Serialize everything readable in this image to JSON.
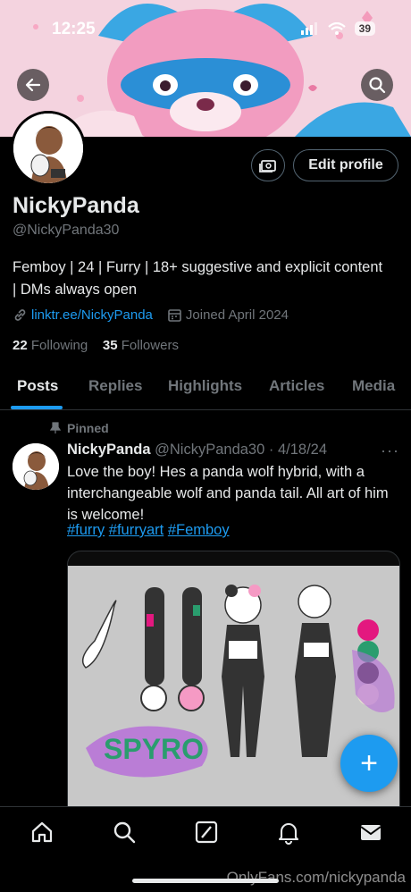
{
  "status_bar": {
    "time": "12:25",
    "battery": "39"
  },
  "profile": {
    "name": "NickyPanda",
    "handle": "@NickyPanda30",
    "bio": "Femboy | 24 | Furry | 18+ suggestive and explicit content | DMs always open",
    "link": "linktr.ee/NickyPanda",
    "joined": "Joined April 2024",
    "following_count": "22",
    "following_label": "Following",
    "followers_count": "35",
    "followers_label": "Followers",
    "edit_label": "Edit profile"
  },
  "tabs": [
    "Posts",
    "Replies",
    "Highlights",
    "Articles",
    "Media"
  ],
  "post": {
    "pinned_label": "Pinned",
    "author": "NickyPanda",
    "handle_date": "@NickyPanda30 · 4/18/24",
    "more": "···",
    "text": "Love the boy! Hes a panda wolf hybrid, with a interchangeable wolf and panda tail. All art of him is welcome!",
    "hashtags": [
      "#furry",
      "#furryart",
      "#Femboy"
    ]
  },
  "fab_label": "+",
  "watermark": "OnlyFans.com/nickypanda",
  "colors": {
    "accent": "#1d9bf0",
    "muted": "#71767b",
    "border": "#2f3336"
  },
  "icons": [
    "back-arrow-icon",
    "search-icon",
    "money-icon",
    "link-icon",
    "calendar-icon",
    "pin-icon",
    "home-icon",
    "nav-search-icon",
    "grok-icon",
    "bell-icon",
    "mail-icon"
  ]
}
